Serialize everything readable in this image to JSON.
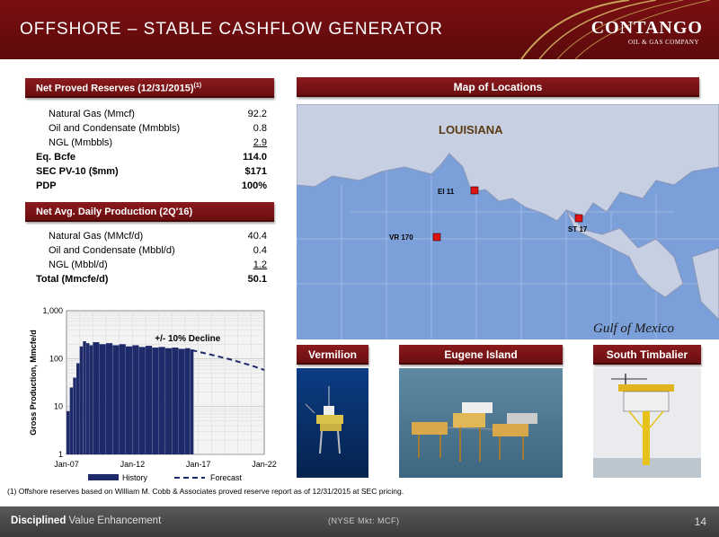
{
  "header": {
    "title": "OFFSHORE – STABLE CASHFLOW GENERATOR",
    "logo_name": "CONTANGO",
    "logo_sub": "OIL & GAS COMPANY"
  },
  "reserves": {
    "heading": "Net Proved Reserves (12/31/2015)",
    "heading_note": "(1)",
    "rows": [
      {
        "label": "Natural Gas (Mmcf)",
        "value": "92.2"
      },
      {
        "label": "Oil and Condensate (Mmbbls)",
        "value": "0.8"
      },
      {
        "label": "NGL (Mmbbls)",
        "value": "2.9"
      },
      {
        "label": "Eq. Bcfe",
        "value": "114.0"
      },
      {
        "label": "SEC PV-10 ($mm)",
        "value": "$171"
      },
      {
        "label": "PDP",
        "value": "100%"
      }
    ]
  },
  "production": {
    "heading": "Net Avg. Daily Production (2Q'16)",
    "rows": [
      {
        "label": "Natural Gas (MMcf/d)",
        "value": "40.4"
      },
      {
        "label": "Oil and Condensate (Mbbl/d)",
        "value": "0.4"
      },
      {
        "label": "NGL (Mbbl/d)",
        "value": "1.2"
      },
      {
        "label": "Total (Mmcfe/d)",
        "value": "50.1"
      }
    ]
  },
  "chart_data": {
    "type": "bar",
    "ylabel": "Gross Production, Mmcfe/d",
    "y_scale": "log",
    "ylim": [
      1,
      1000
    ],
    "y_ticks": [
      "1",
      "10",
      "100",
      "1,000"
    ],
    "x_ticks": [
      "Jan-07",
      "Jan-12",
      "Jan-17",
      "Jan-22"
    ],
    "annotation": "+/- 10% Decline",
    "series": [
      {
        "name": "History",
        "type": "bar",
        "x": [
          2007.0,
          2007.25,
          2007.5,
          2007.75,
          2008.0,
          2008.25,
          2008.5,
          2008.75,
          2009.0,
          2009.5,
          2010.0,
          2010.5,
          2011.0,
          2011.5,
          2012.0,
          2012.5,
          2013.0,
          2013.5,
          2014.0,
          2014.5,
          2015.0,
          2015.5,
          2016.0,
          2016.4
        ],
        "values": [
          8,
          25,
          40,
          80,
          180,
          230,
          210,
          190,
          220,
          200,
          210,
          190,
          200,
          180,
          190,
          175,
          185,
          170,
          175,
          165,
          170,
          160,
          165,
          155
        ]
      },
      {
        "name": "Forecast",
        "type": "line",
        "x": [
          2016.5,
          2018,
          2019.5,
          2021,
          2022
        ],
        "values": [
          150,
          120,
          95,
          72,
          58
        ]
      }
    ]
  },
  "map": {
    "heading": "Map of Locations",
    "state_label": "LOUISIANA",
    "sea_label": "Gulf of Mexico",
    "markers": [
      {
        "label": "EI 11"
      },
      {
        "label": "VR 170"
      },
      {
        "label": "ST 17"
      }
    ]
  },
  "photos": [
    {
      "label": "Vermilion"
    },
    {
      "label": "Eugene Island"
    },
    {
      "label": "South Timbalier"
    }
  ],
  "footnote": "(1) Offshore reserves based on William M. Cobb & Associates proved reserve report as of 12/31/2015 at SEC pricing.",
  "footer": {
    "tagline_bold": "Disciplined",
    "tagline_rest": " Value Enhancement",
    "ticker": "(NYSE Mkt: MCF)",
    "page": "14"
  },
  "colors": {
    "brand_red": "#7a0f12",
    "history_bar": "#1f2a6b",
    "map_water": "#7b9fd8"
  }
}
